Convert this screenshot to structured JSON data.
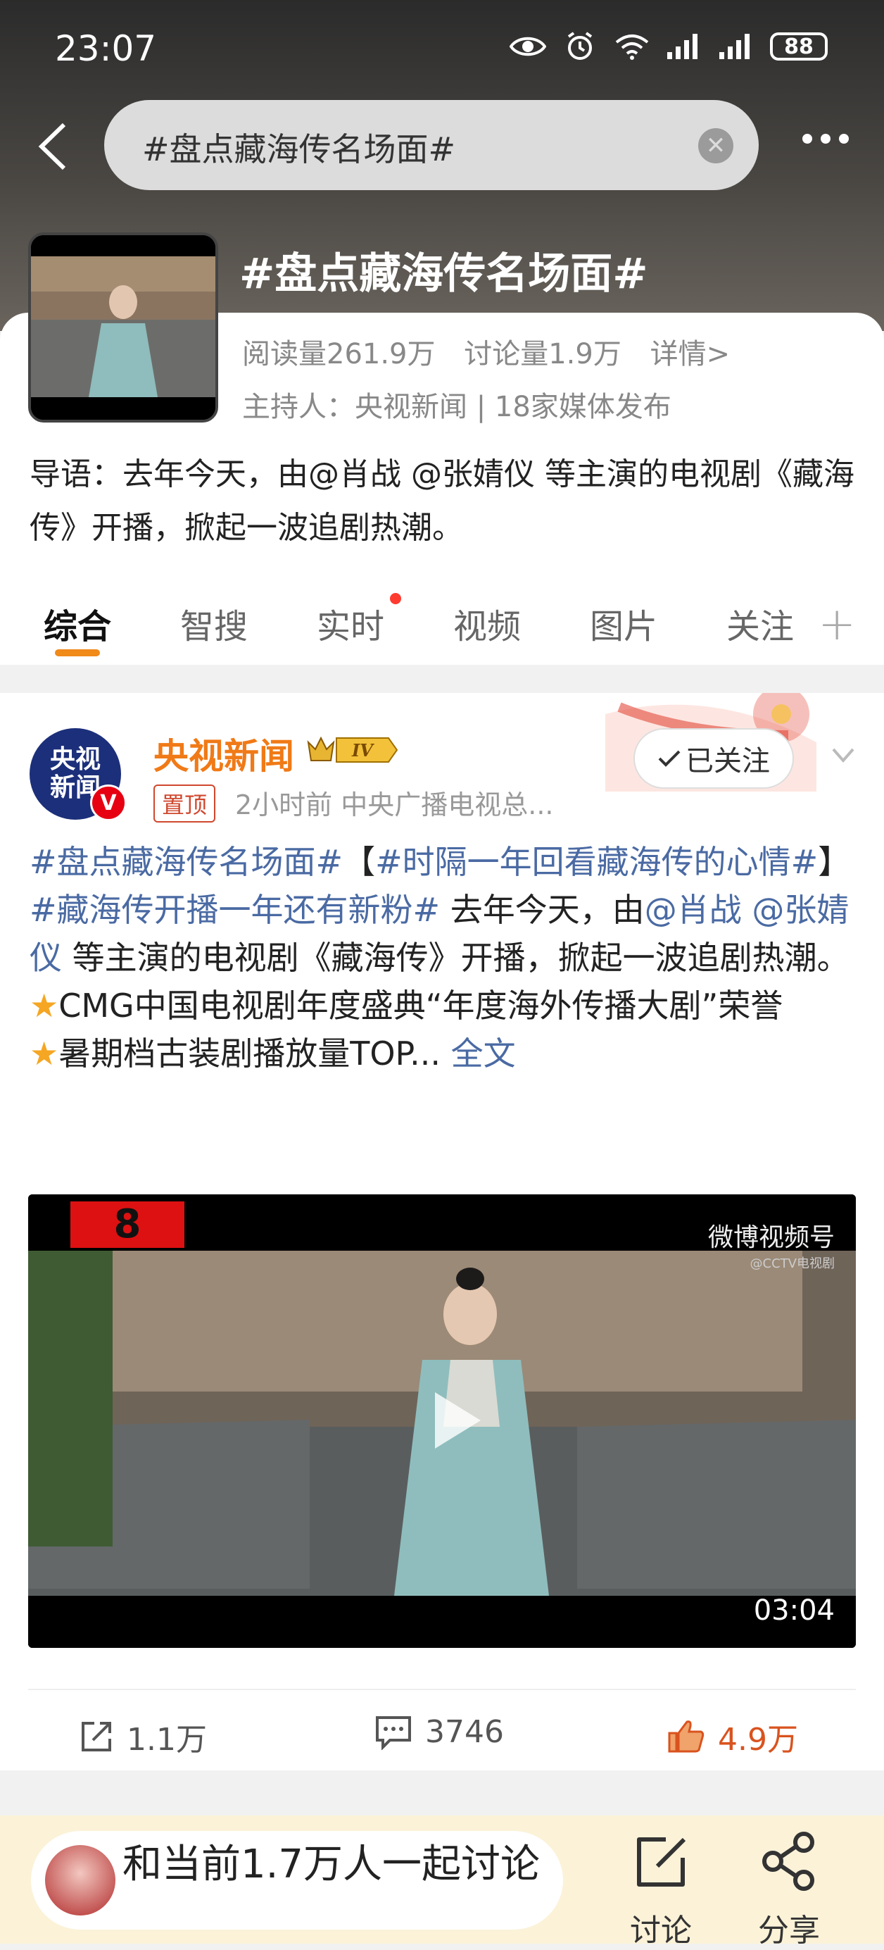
{
  "status": {
    "time": "23:07",
    "battery": "88"
  },
  "search": {
    "query": "#盘点藏海传名场面#"
  },
  "topic": {
    "title": "#盘点藏海传名场面#",
    "reads": "阅读量261.9万",
    "discussions": "讨论量1.9万",
    "details": "详情>",
    "host": "主持人：央视新闻 | 18家媒体发布",
    "intro": "导语：去年今天，由@肖战 @张婧仪 等主演的电视剧《藏海传》开播，掀起一波追剧热潮。"
  },
  "tabs": [
    "综合",
    "智搜",
    "实时",
    "视频",
    "图片",
    "关注"
  ],
  "post": {
    "avatar_line1": "央视",
    "avatar_line2": "新闻",
    "author": "央视新闻",
    "pin": "置顶",
    "meta": "2小时前   中央广播电视总...",
    "follow": "已关注",
    "t1": "#盘点藏海传名场面#",
    "t2": "【",
    "t3": "#时隔一年回看藏海传的心情#",
    "t4": "】",
    "t5": "#藏海传开播一年还有新粉#",
    "t6": " 去年今天，由",
    "t7": "@肖战",
    "t8": " ",
    "t9": "@张婧仪",
    "t10": " 等主演的电视剧《藏海传》开播，掀起一波追剧热潮。",
    "line_b1": "CMG中国电视剧年度盛典“年度海外传播大剧”荣誉",
    "line_b2": "暑期档古装剧播放量TOP... ",
    "full_text": "全文",
    "video_duration": "03:04",
    "watermark": "微博视频号",
    "watermark_sub": "@CCTV电视剧",
    "episode": "8",
    "shares": "1.1万",
    "comments": "3746",
    "likes": "4.9万"
  },
  "bottom": {
    "join": "和当前1.7万人一起讨论",
    "discuss": "讨论",
    "share": "分享"
  },
  "colors": {
    "accent": "#f08a19",
    "link": "#4a6aa3",
    "like": "#d9531e"
  }
}
